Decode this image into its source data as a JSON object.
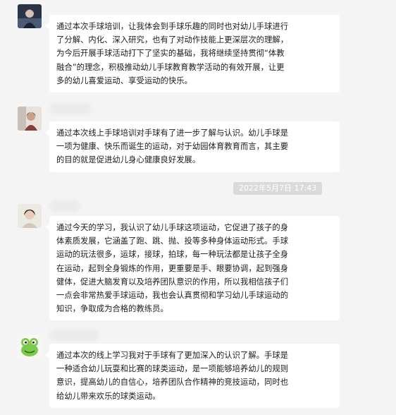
{
  "messages": [
    {
      "avatar_icon": "avatar-portrait-dark-icon",
      "text": "通过本次手球培训，让我体会到手球乐趣的同时也对幼儿手球进行\n了分解、内化、深入研究，也有了对动作技能上更深层次的理解，\n为今后开展手球活动打下了坚实的基础，我将继续坚持贯彻“体教\n融合”的理念，积极推动幼儿手球教育教学活动的有效开展，让更\n多的幼儿喜爱运动、享受运动的快乐。"
    },
    {
      "avatar_icon": "avatar-person-photo-icon",
      "text": "通过本次线上手球培训对手球有了进一步了解与认识。幼儿手球是\n一项为健康、快乐而诞生的运动，对于幼园体育教育而言，其主要\n的目的就是促进幼儿身心健康良好发展。"
    },
    {
      "avatar_icon": "avatar-person-photo-icon",
      "text": "通过今天的学习，我认识了幼儿手球这项运动，它促进了孩子的身\n体素质发展，它涵盖了跑、跳、抛、投等多种身体运动形式。手球\n运动的玩法很多，运球，接球，拍球，每一种玩法都是让孩子全身\n在运动，起到全身锻炼的作用，更重要是手、眼要协调，起到强身\n健体，促进大脑发育以及培养团队意识的作用，所以我相信孩子们\n一点会非常热爱手球运动，我也会认真贯彻和学习幼儿手球运动的\n知识，争取成为合格的教练员。"
    },
    {
      "avatar_icon": "avatar-green-frog-icon",
      "text": "通过本次的线上学习我对于手球有了更加深入的认识了解。手球是\n一种适合幼儿玩耍和比赛的球类运动，是一项能够培养幼儿的规则\n意识，提高幼儿的自信心，培养团队合作精神的竞技运动，同时也\n给幼儿带来欢乐的球类运动。"
    }
  ],
  "timestamp": "2022年5月7日 17:43"
}
